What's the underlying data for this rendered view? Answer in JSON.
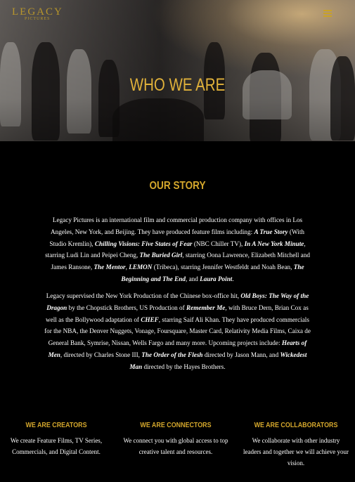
{
  "header": {
    "logo_text": "LEGACY",
    "logo_subtext": "PICTURES",
    "menu_icon": "hamburger-menu-icon",
    "hero_title": "WHO WE ARE"
  },
  "story": {
    "title": "OUR STORY",
    "p1": [
      {
        "t": "Legacy Pictures is an international film and commercial production company with offices in Los Angeles, New York, and Beijing. They have produced feature films including: "
      },
      {
        "t": "A True Story",
        "em": true
      },
      {
        "t": " (With Studio Kremlin), "
      },
      {
        "t": "Chilling Visions: Five States of Fear",
        "em": true
      },
      {
        "t": " (NBC Chiller TV), "
      },
      {
        "t": "In A New York Minute",
        "em": true
      },
      {
        "t": ", starring Ludi Lin and Peipei Cheng, "
      },
      {
        "t": "The Buried Girl",
        "em": true
      },
      {
        "t": ", starring Oona Lawrence, Elizabeth Mitchell and James Ransone, "
      },
      {
        "t": "The Mentor",
        "em": true
      },
      {
        "t": ", "
      },
      {
        "t": "LEMON",
        "em": true
      },
      {
        "t": " (Tribeca), starring Jennifer Westfeldt and Noah Bean, "
      },
      {
        "t": "The Beginning and The End",
        "em": true
      },
      {
        "t": ", and "
      },
      {
        "t": "Laura Point",
        "em": true
      },
      {
        "t": "."
      }
    ],
    "p2": [
      {
        "t": "Legacy supervised the New York Production of the Chinese box-office hit, "
      },
      {
        "t": "Old Boys: The Way of the Dragon",
        "em": true
      },
      {
        "t": " by the Chopstick Brothers, US Production of "
      },
      {
        "t": "Remember Me",
        "em": true
      },
      {
        "t": ", with Bruce Dern, Brian Cox as well as the Bollywood adaptation of "
      },
      {
        "t": "CHEF",
        "em": true
      },
      {
        "t": ", starring Saif Ali Khan. They have produced commercials for the NBA, the Denver Nuggets, Vonage, Foursquare, Master Card, Relativity Media Films, Caixa de General Bank, Symrise, Nissan, Wells Fargo and many more. Upcoming projects include: "
      },
      {
        "t": "Hearts of Men",
        "em": true
      },
      {
        "t": ", directed by Charles Stone III,  "
      },
      {
        "t": "The Order of the Flesh",
        "em": true
      },
      {
        "t": " directed by Jason Mann, and "
      },
      {
        "t": "Wickedest Man",
        "em": true
      },
      {
        "t": " directed by the Hayes Brothers."
      }
    ]
  },
  "columns": [
    {
      "title": "WE ARE CREATORS",
      "text": "We create Feature Films,  TV Series, Commercials, and Digital Content."
    },
    {
      "title": "WE ARE CONNECTORS",
      "text": "We connect you with global access to top creative talent and resources."
    },
    {
      "title": "WE ARE COLLABORATORS",
      "text": "We collaborate with other industry leaders and together we will achieve your vision."
    }
  ],
  "colors": {
    "accent": "#d4a72c",
    "background": "#000000",
    "text": "#ffffff"
  }
}
